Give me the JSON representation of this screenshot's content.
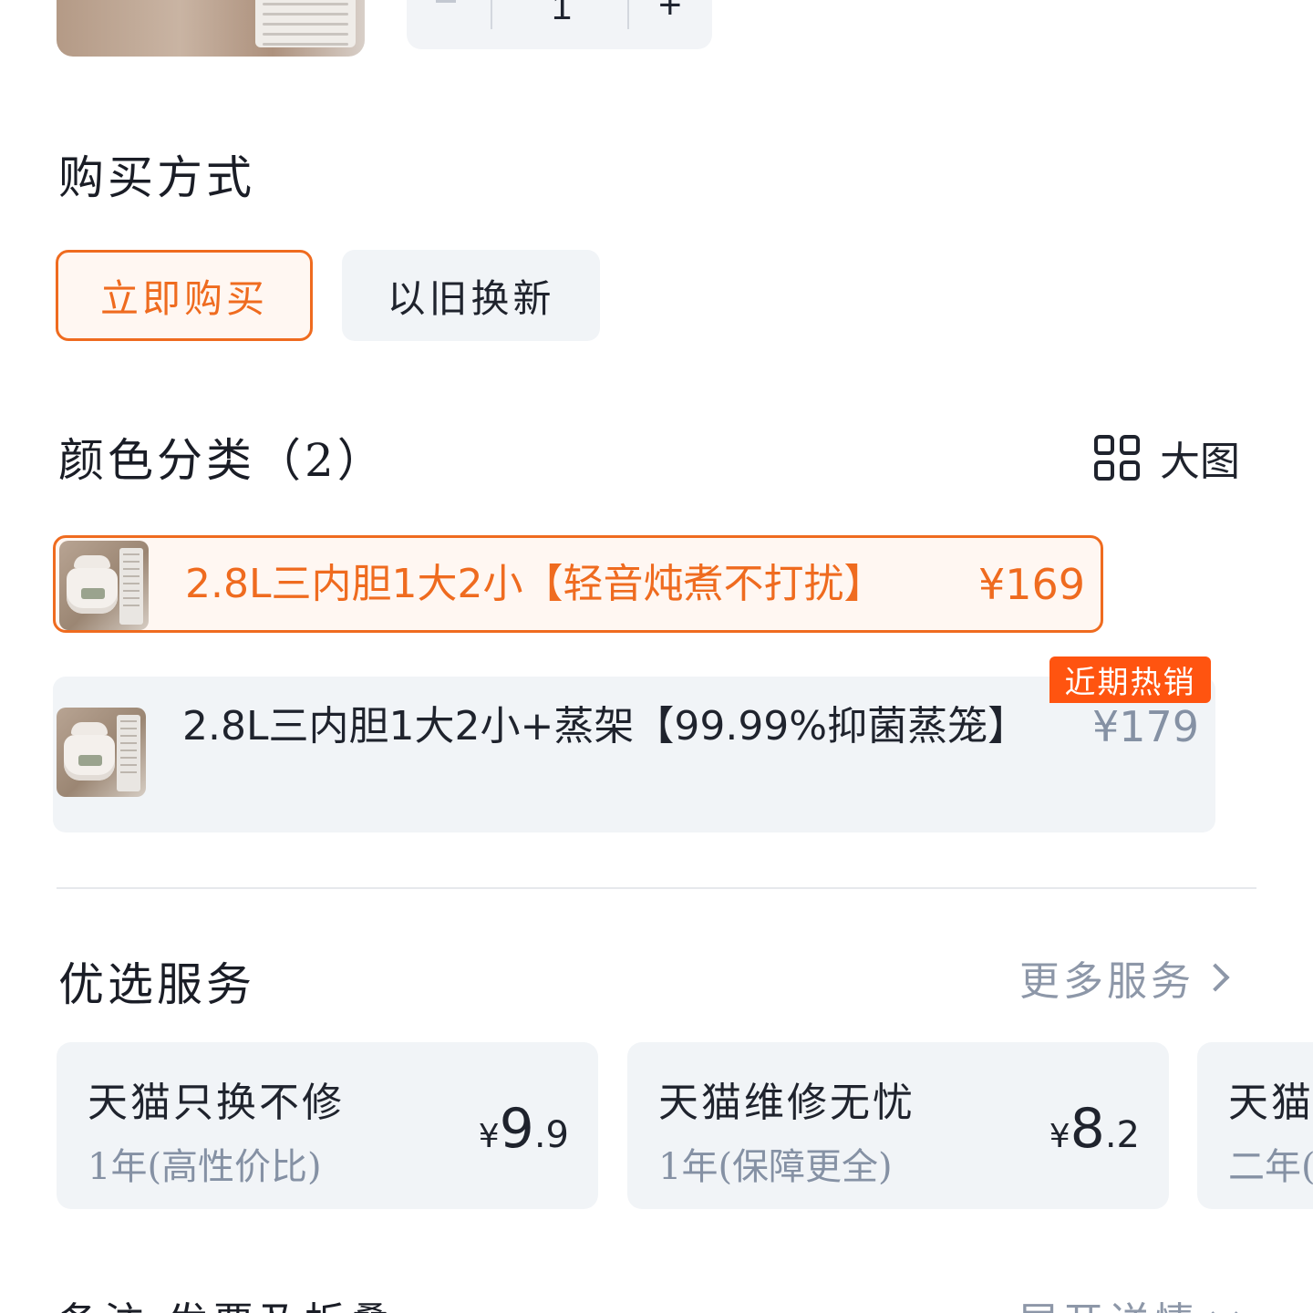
{
  "quantity": {
    "value": "1",
    "minus": "−",
    "plus": "+"
  },
  "purchase": {
    "title": "购买方式",
    "options": [
      {
        "label": "立即购买",
        "selected": true
      },
      {
        "label": "以旧换新",
        "selected": false
      }
    ]
  },
  "color": {
    "title": "颜色分类（2）",
    "big_image_label": "大图",
    "big_image_icon": "grid-icon",
    "items": [
      {
        "label": "2.8L三内胆1大2小【轻音炖煮不打扰】",
        "price": "¥169",
        "selected": true
      },
      {
        "label": "2.8L三内胆1大2小+蒸架【99.99%抑菌蒸笼】",
        "price": "¥179",
        "selected": false,
        "badge": "近期热销"
      }
    ]
  },
  "services": {
    "title": "优选服务",
    "more_label": "更多服务",
    "cards": [
      {
        "name": "天猫只换不修",
        "sub": "1年(高性价比)",
        "currency": "¥",
        "int": "9",
        "dec": ".9"
      },
      {
        "name": "天猫维修无忧",
        "sub": "1年(保障更全)",
        "currency": "¥",
        "int": "8",
        "dec": ".2"
      },
      {
        "name": "天猫",
        "sub": "二年("
      }
    ]
  },
  "bottom": {
    "left": "备注 发票及折叠",
    "right": "展开详情"
  },
  "colors": {
    "accent": "#ef6b1f",
    "badge": "#ff5410",
    "muted": "#8591a4",
    "card_bg": "#f1f4f7"
  }
}
